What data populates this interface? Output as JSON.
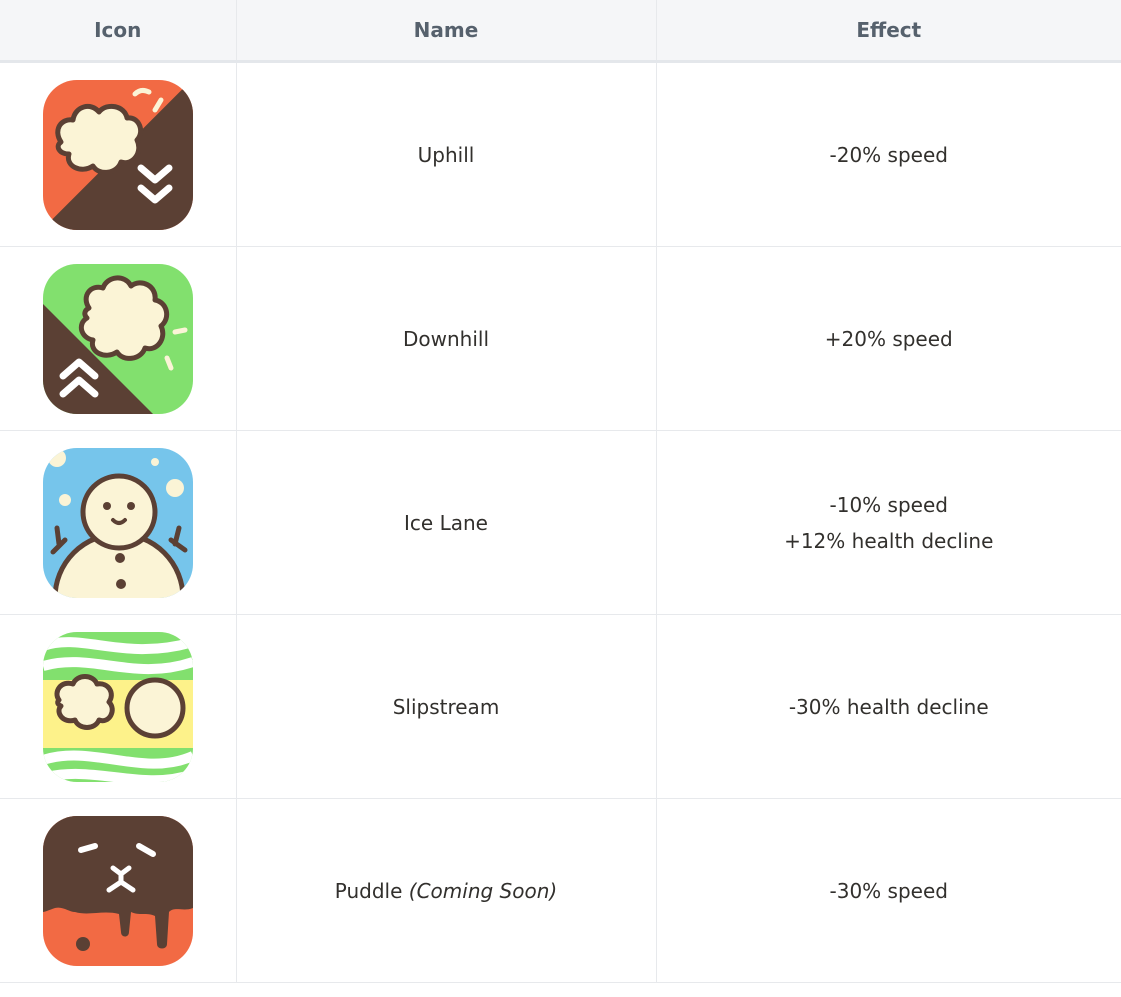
{
  "table": {
    "headers": {
      "icon": "Icon",
      "name": "Name",
      "effect": "Effect"
    },
    "rows": [
      {
        "icon": "uphill-icon",
        "name": "Uphill",
        "name_note": "",
        "effects": [
          "-20% speed"
        ]
      },
      {
        "icon": "downhill-icon",
        "name": "Downhill",
        "name_note": "",
        "effects": [
          "+20% speed"
        ]
      },
      {
        "icon": "snowman-icon",
        "name": "Ice Lane",
        "name_note": "",
        "effects": [
          "-10% speed",
          "+12% health decline"
        ]
      },
      {
        "icon": "slipstream-icon",
        "name": "Slipstream",
        "name_note": "",
        "effects": [
          "-30% health decline"
        ]
      },
      {
        "icon": "puddle-icon",
        "name": "Puddle",
        "name_note": "(Coming Soon)",
        "effects": [
          "-30% speed"
        ]
      }
    ]
  },
  "colors": {
    "header_bg": "#f5f6f8",
    "header_text": "#56616d",
    "border": "#e7e9ec",
    "icon_orange": "#f26a44",
    "icon_brown": "#5b4034",
    "icon_green": "#82e06e",
    "icon_blue": "#76c5eb",
    "icon_yellow": "#fdf28a",
    "icon_cream": "#fbf4d6"
  }
}
